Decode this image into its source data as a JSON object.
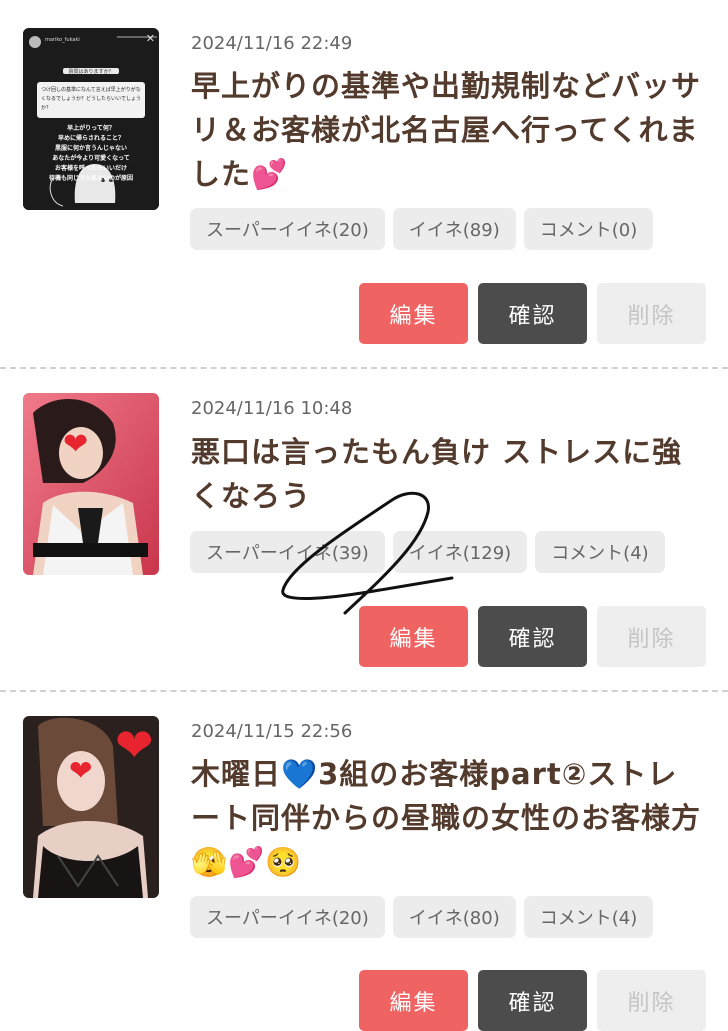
{
  "posts": [
    {
      "date": "2024/11/16 22:49",
      "title": "早上がりの基準や出勤規制などバッサリ＆お客様が北名古屋へ行ってくれました💕",
      "stats": {
        "super_like": "スーパーイイネ(20)",
        "like": "イイネ(89)",
        "comment": "コメント(0)"
      },
      "thumb": {
        "handle": "mariko_fukaki",
        "lines": [
          "質問はありますか？",
          "つけ回しの基準になんて言えば早上がりがなくなるでしょうか？どうしたらいいでしょうか？",
          "早上がりって何？",
          "早めに帰らされること？",
          "黒服に何か言うんじゃない",
          "あなたが今より可愛くなって",
          "お客様を呼べたらいいだけ",
          "待機も同じで人気ないのが原因"
        ]
      }
    },
    {
      "date": "2024/11/16 10:48",
      "title": "悪口は言ったもん負け ストレスに強くなろう",
      "stats": {
        "super_like": "スーパーイイネ(39)",
        "like": "イイネ(129)",
        "comment": "コメント(4)"
      }
    },
    {
      "date": "2024/11/15 22:56",
      "title": "木曜日💙3組のお客様part②ストレート同伴からの昼職の女性のお客様方🫣💕🥺",
      "stats": {
        "super_like": "スーパーイイネ(20)",
        "like": "イイネ(80)",
        "comment": "コメント(4)"
      }
    }
  ],
  "actions": {
    "edit": "編集",
    "confirm": "確認",
    "delete": "削除"
  },
  "colors": {
    "edit": "#ef6363",
    "confirm": "#4c4c4c",
    "delete": "#eeeeee",
    "title": "#523a2c"
  }
}
